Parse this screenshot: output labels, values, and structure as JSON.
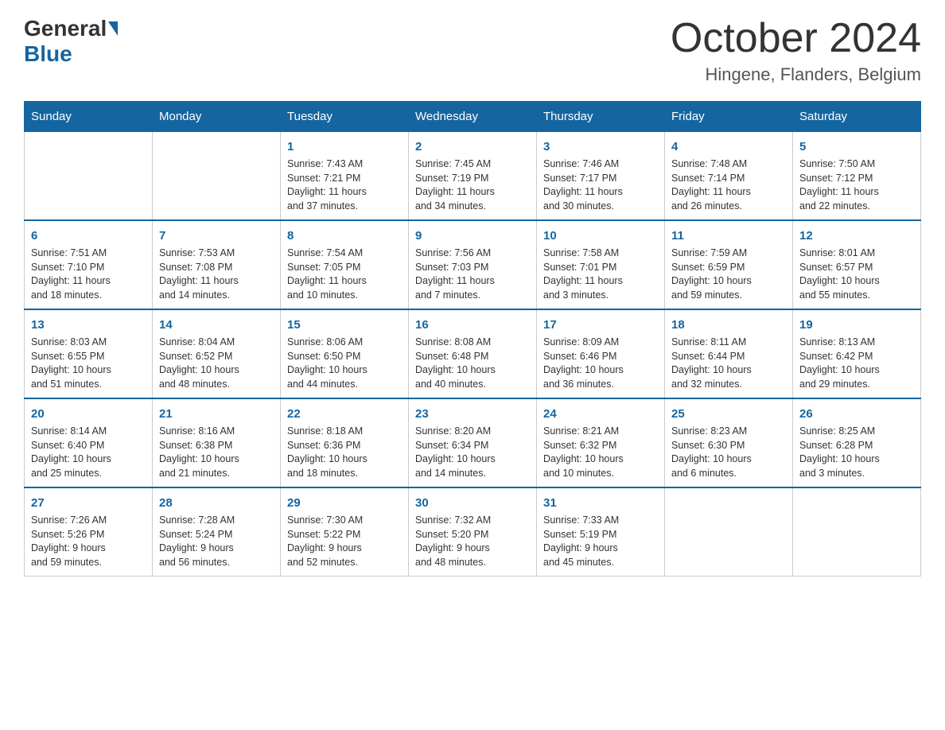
{
  "header": {
    "logo_general": "General",
    "logo_blue": "Blue",
    "month_title": "October 2024",
    "location": "Hingene, Flanders, Belgium"
  },
  "days_of_week": [
    "Sunday",
    "Monday",
    "Tuesday",
    "Wednesday",
    "Thursday",
    "Friday",
    "Saturday"
  ],
  "weeks": [
    [
      {
        "day": "",
        "info": ""
      },
      {
        "day": "",
        "info": ""
      },
      {
        "day": "1",
        "info": "Sunrise: 7:43 AM\nSunset: 7:21 PM\nDaylight: 11 hours\nand 37 minutes."
      },
      {
        "day": "2",
        "info": "Sunrise: 7:45 AM\nSunset: 7:19 PM\nDaylight: 11 hours\nand 34 minutes."
      },
      {
        "day": "3",
        "info": "Sunrise: 7:46 AM\nSunset: 7:17 PM\nDaylight: 11 hours\nand 30 minutes."
      },
      {
        "day": "4",
        "info": "Sunrise: 7:48 AM\nSunset: 7:14 PM\nDaylight: 11 hours\nand 26 minutes."
      },
      {
        "day": "5",
        "info": "Sunrise: 7:50 AM\nSunset: 7:12 PM\nDaylight: 11 hours\nand 22 minutes."
      }
    ],
    [
      {
        "day": "6",
        "info": "Sunrise: 7:51 AM\nSunset: 7:10 PM\nDaylight: 11 hours\nand 18 minutes."
      },
      {
        "day": "7",
        "info": "Sunrise: 7:53 AM\nSunset: 7:08 PM\nDaylight: 11 hours\nand 14 minutes."
      },
      {
        "day": "8",
        "info": "Sunrise: 7:54 AM\nSunset: 7:05 PM\nDaylight: 11 hours\nand 10 minutes."
      },
      {
        "day": "9",
        "info": "Sunrise: 7:56 AM\nSunset: 7:03 PM\nDaylight: 11 hours\nand 7 minutes."
      },
      {
        "day": "10",
        "info": "Sunrise: 7:58 AM\nSunset: 7:01 PM\nDaylight: 11 hours\nand 3 minutes."
      },
      {
        "day": "11",
        "info": "Sunrise: 7:59 AM\nSunset: 6:59 PM\nDaylight: 10 hours\nand 59 minutes."
      },
      {
        "day": "12",
        "info": "Sunrise: 8:01 AM\nSunset: 6:57 PM\nDaylight: 10 hours\nand 55 minutes."
      }
    ],
    [
      {
        "day": "13",
        "info": "Sunrise: 8:03 AM\nSunset: 6:55 PM\nDaylight: 10 hours\nand 51 minutes."
      },
      {
        "day": "14",
        "info": "Sunrise: 8:04 AM\nSunset: 6:52 PM\nDaylight: 10 hours\nand 48 minutes."
      },
      {
        "day": "15",
        "info": "Sunrise: 8:06 AM\nSunset: 6:50 PM\nDaylight: 10 hours\nand 44 minutes."
      },
      {
        "day": "16",
        "info": "Sunrise: 8:08 AM\nSunset: 6:48 PM\nDaylight: 10 hours\nand 40 minutes."
      },
      {
        "day": "17",
        "info": "Sunrise: 8:09 AM\nSunset: 6:46 PM\nDaylight: 10 hours\nand 36 minutes."
      },
      {
        "day": "18",
        "info": "Sunrise: 8:11 AM\nSunset: 6:44 PM\nDaylight: 10 hours\nand 32 minutes."
      },
      {
        "day": "19",
        "info": "Sunrise: 8:13 AM\nSunset: 6:42 PM\nDaylight: 10 hours\nand 29 minutes."
      }
    ],
    [
      {
        "day": "20",
        "info": "Sunrise: 8:14 AM\nSunset: 6:40 PM\nDaylight: 10 hours\nand 25 minutes."
      },
      {
        "day": "21",
        "info": "Sunrise: 8:16 AM\nSunset: 6:38 PM\nDaylight: 10 hours\nand 21 minutes."
      },
      {
        "day": "22",
        "info": "Sunrise: 8:18 AM\nSunset: 6:36 PM\nDaylight: 10 hours\nand 18 minutes."
      },
      {
        "day": "23",
        "info": "Sunrise: 8:20 AM\nSunset: 6:34 PM\nDaylight: 10 hours\nand 14 minutes."
      },
      {
        "day": "24",
        "info": "Sunrise: 8:21 AM\nSunset: 6:32 PM\nDaylight: 10 hours\nand 10 minutes."
      },
      {
        "day": "25",
        "info": "Sunrise: 8:23 AM\nSunset: 6:30 PM\nDaylight: 10 hours\nand 6 minutes."
      },
      {
        "day": "26",
        "info": "Sunrise: 8:25 AM\nSunset: 6:28 PM\nDaylight: 10 hours\nand 3 minutes."
      }
    ],
    [
      {
        "day": "27",
        "info": "Sunrise: 7:26 AM\nSunset: 5:26 PM\nDaylight: 9 hours\nand 59 minutes."
      },
      {
        "day": "28",
        "info": "Sunrise: 7:28 AM\nSunset: 5:24 PM\nDaylight: 9 hours\nand 56 minutes."
      },
      {
        "day": "29",
        "info": "Sunrise: 7:30 AM\nSunset: 5:22 PM\nDaylight: 9 hours\nand 52 minutes."
      },
      {
        "day": "30",
        "info": "Sunrise: 7:32 AM\nSunset: 5:20 PM\nDaylight: 9 hours\nand 48 minutes."
      },
      {
        "day": "31",
        "info": "Sunrise: 7:33 AM\nSunset: 5:19 PM\nDaylight: 9 hours\nand 45 minutes."
      },
      {
        "day": "",
        "info": ""
      },
      {
        "day": "",
        "info": ""
      }
    ]
  ]
}
